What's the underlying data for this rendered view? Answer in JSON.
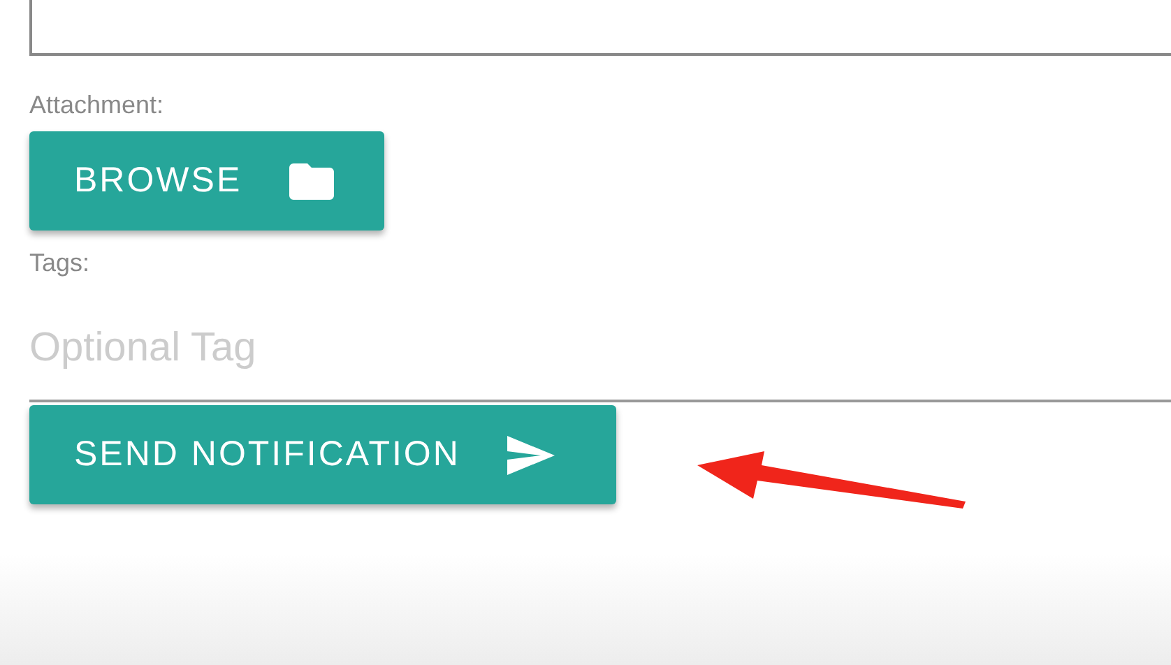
{
  "message_field": {
    "kind": "textarea"
  },
  "attachment": {
    "label": "Attachment:",
    "button": "BROWSE"
  },
  "tags": {
    "label": "Tags:",
    "placeholder": "Optional Tag"
  },
  "submit": {
    "label": "SEND NOTIFICATION"
  }
}
